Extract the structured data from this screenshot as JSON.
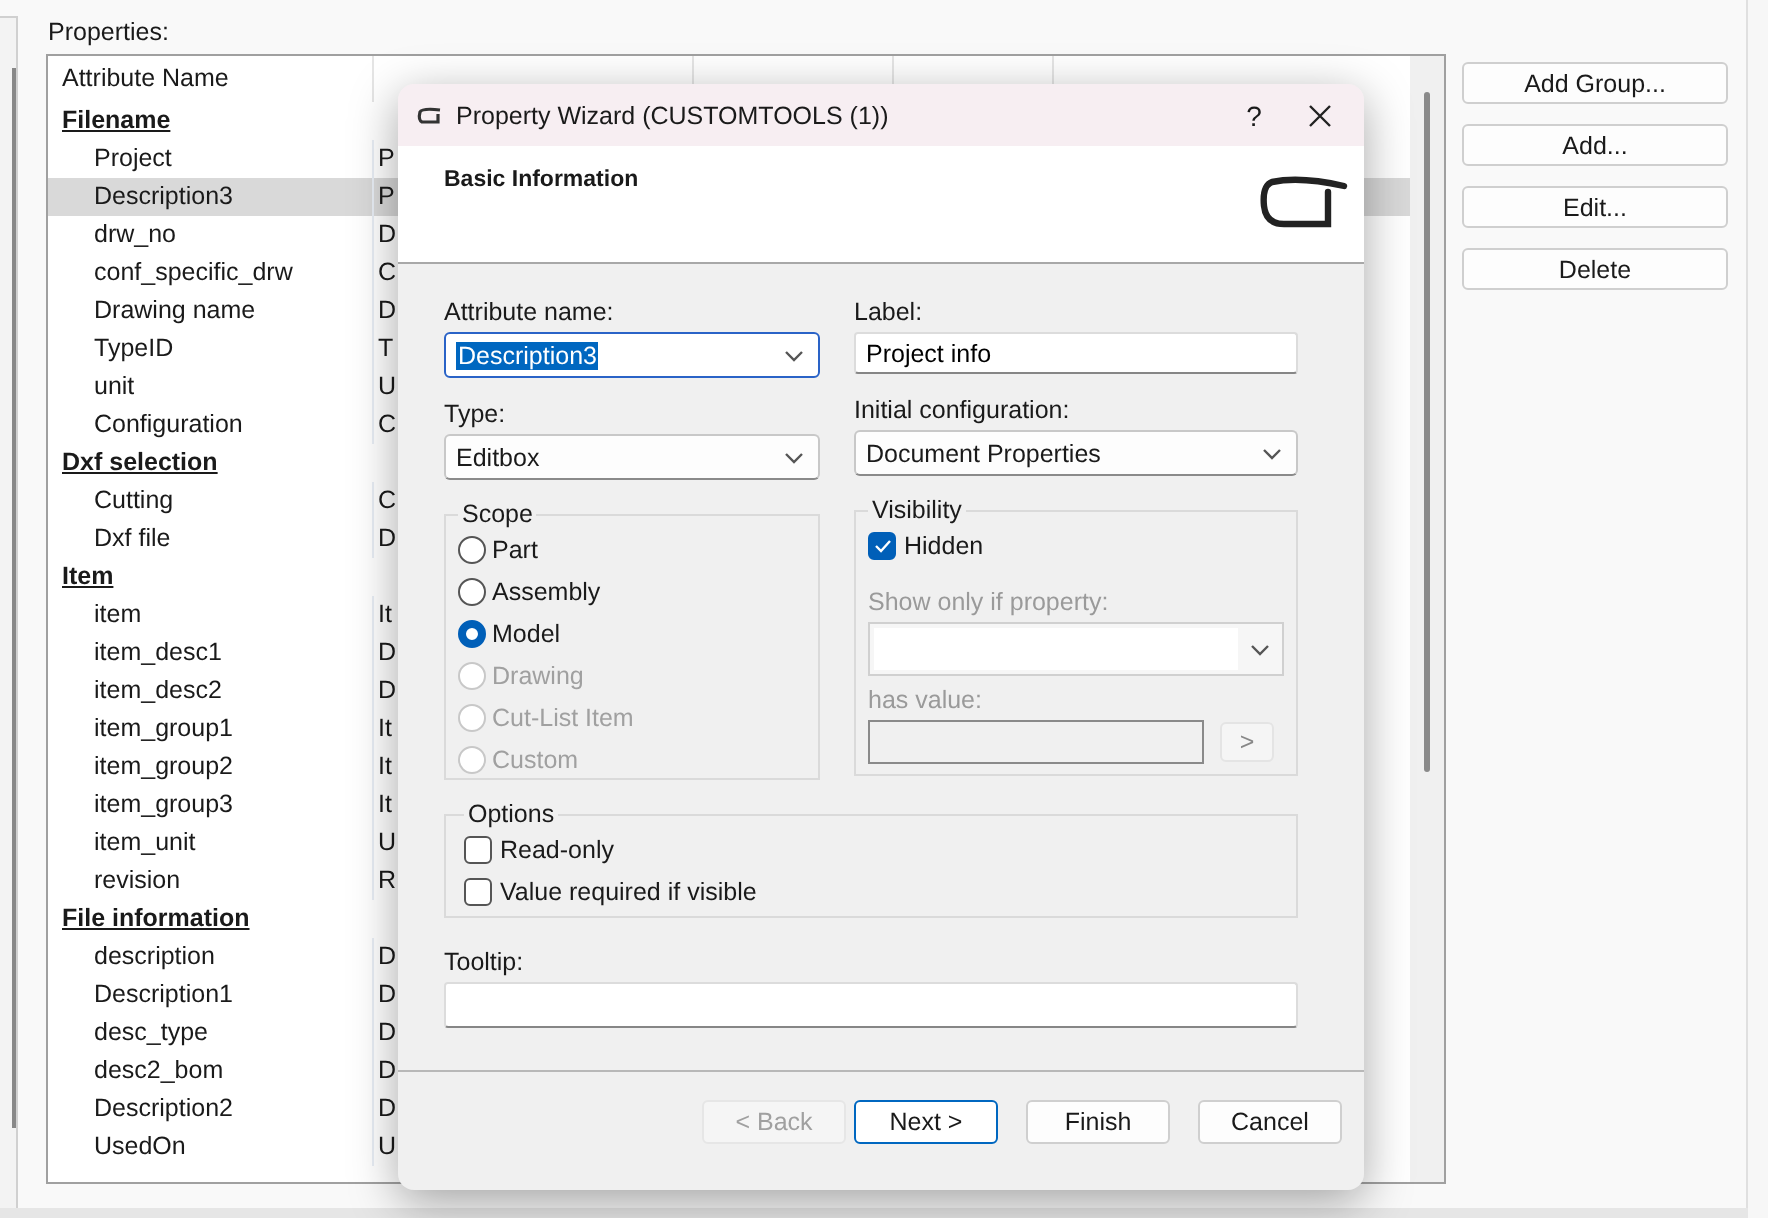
{
  "properties_label": "Properties:",
  "table": {
    "columns": [
      "Attribute Name"
    ],
    "groups": [
      {
        "name": "Filename",
        "rows": [
          {
            "name": "Project",
            "label": "P",
            "selected": false
          },
          {
            "name": "Description3",
            "label": "P",
            "selected": true
          },
          {
            "name": "drw_no",
            "label": "D",
            "selected": false
          },
          {
            "name": "conf_specific_drw",
            "label": "C",
            "selected": false
          },
          {
            "name": "Drawing name",
            "label": "D",
            "selected": false
          },
          {
            "name": "TypeID",
            "label": "T",
            "selected": false
          },
          {
            "name": "unit",
            "label": "U",
            "selected": false
          },
          {
            "name": "Configuration",
            "label": "C",
            "selected": false
          }
        ]
      },
      {
        "name": "Dxf selection",
        "rows": [
          {
            "name": "Cutting",
            "label": "C",
            "selected": false
          },
          {
            "name": "Dxf file",
            "label": "D",
            "selected": false
          }
        ]
      },
      {
        "name": "Item",
        "rows": [
          {
            "name": "item",
            "label": "It",
            "selected": false
          },
          {
            "name": "item_desc1",
            "label": "D",
            "selected": false
          },
          {
            "name": "item_desc2",
            "label": "D",
            "selected": false
          },
          {
            "name": "item_group1",
            "label": "It",
            "selected": false
          },
          {
            "name": "item_group2",
            "label": "It",
            "selected": false
          },
          {
            "name": "item_group3",
            "label": "It",
            "selected": false
          },
          {
            "name": "item_unit",
            "label": "U",
            "selected": false
          },
          {
            "name": "revision",
            "label": "R",
            "selected": false
          }
        ]
      },
      {
        "name": "File information",
        "rows": [
          {
            "name": "description",
            "label": "D",
            "selected": false
          },
          {
            "name": "Description1",
            "label": "D",
            "selected": false
          },
          {
            "name": "desc_type",
            "label": "D",
            "selected": false
          },
          {
            "name": "desc2_bom",
            "label": "D",
            "selected": false
          },
          {
            "name": "Description2",
            "label": "D",
            "selected": false
          },
          {
            "name": "UsedOn",
            "label": "U",
            "selected": false
          }
        ]
      }
    ]
  },
  "buttons": [
    "Add Group...",
    "Add...",
    "Edit...",
    "Delete"
  ],
  "dialog": {
    "title": "Property Wizard (CUSTOMTOOLS (1))",
    "help": "?",
    "heading": "Basic Information",
    "attribute_name": {
      "label": "Attribute name:",
      "value": "Description3"
    },
    "label": {
      "label": "Label:",
      "value": "Project info"
    },
    "type": {
      "label": "Type:",
      "value": "Editbox"
    },
    "initial_configuration": {
      "label": "Initial configuration:",
      "value": "Document Properties"
    },
    "scope": {
      "title": "Scope",
      "options": [
        {
          "label": "Part",
          "selected": false,
          "disabled": false
        },
        {
          "label": "Assembly",
          "selected": false,
          "disabled": false
        },
        {
          "label": "Model",
          "selected": true,
          "disabled": false
        },
        {
          "label": "Drawing",
          "selected": false,
          "disabled": true
        },
        {
          "label": "Cut-List Item",
          "selected": false,
          "disabled": true
        },
        {
          "label": "Custom",
          "selected": false,
          "disabled": true
        }
      ]
    },
    "visibility": {
      "title": "Visibility",
      "hidden": {
        "label": "Hidden",
        "checked": true
      },
      "show_only_label": "Show only if property:",
      "has_value_label": "has value:",
      "apply_button": ">",
      "disabled": true
    },
    "options": {
      "title": "Options",
      "items": [
        {
          "label": "Read-only",
          "checked": false
        },
        {
          "label": "Value required if visible",
          "checked": false
        }
      ]
    },
    "tooltip": {
      "label": "Tooltip:"
    },
    "footer_buttons": [
      {
        "label": "< Back",
        "kind": "normal",
        "disabled": true
      },
      {
        "label": "Next >",
        "kind": "default",
        "disabled": false
      },
      {
        "label": "Finish",
        "kind": "normal",
        "disabled": false
      },
      {
        "label": "Cancel",
        "kind": "normal",
        "disabled": false
      }
    ]
  }
}
